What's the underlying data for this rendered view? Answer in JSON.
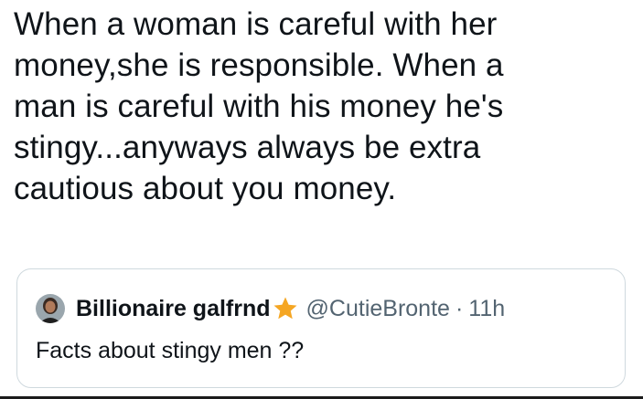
{
  "tweet": {
    "text": "When a woman is careful with her\nmoney,she is responsible. When a\nman is careful with his money he's\nstingy...anyways always be extra\ncautious about you money."
  },
  "quote": {
    "author_name": "Billionaire galfrnd",
    "badge_icon": "star-icon",
    "handle": "@CutieBronte",
    "separator": "·",
    "timestamp": "11h",
    "text": "Facts about stingy men ??"
  },
  "colors": {
    "text_primary": "#0f1419",
    "text_secondary": "#536471",
    "card_border": "#cfd9de",
    "star": "#f5a623"
  }
}
